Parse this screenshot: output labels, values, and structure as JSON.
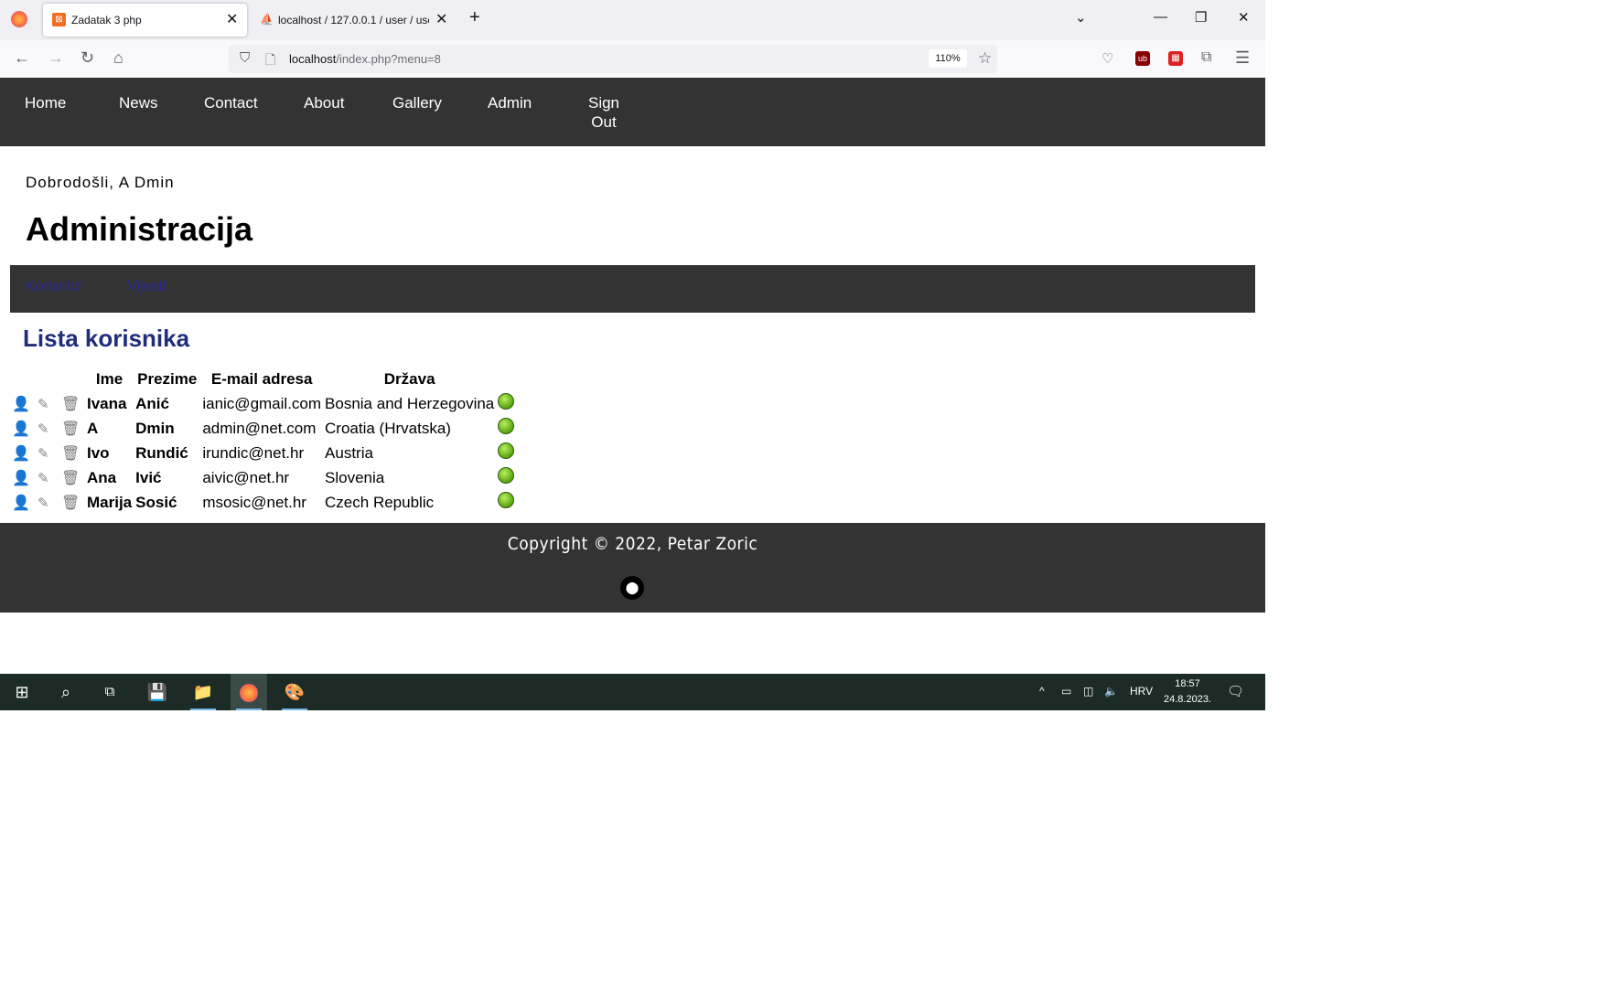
{
  "browser": {
    "tabs": [
      {
        "title": "Zadatak 3 php",
        "favicon": "xampp-icon",
        "active": true
      },
      {
        "title": "localhost / 127.0.0.1 / user / use",
        "favicon": "phpmyadmin-icon",
        "active": false
      }
    ],
    "url": {
      "host": "localhost",
      "path": "/index.php?menu=8"
    },
    "zoom": "110%"
  },
  "site": {
    "nav": [
      "Home",
      "News",
      "Contact",
      "About",
      "Gallery",
      "Admin",
      "Sign\nOut"
    ],
    "welcome": "Dobrodošli, A Dmin",
    "title": "Administracija",
    "subnav": [
      "Korisnici",
      "Vijesti"
    ],
    "list_title": "Lista korisnika",
    "table": {
      "headers": [
        "Ime",
        "Prezime",
        "E-mail adresa",
        "Država"
      ],
      "rows": [
        {
          "ime": "Ivana",
          "prezime": "Anić",
          "email": "ianic@gmail.com",
          "drzava": "Bosnia and Herzegovina"
        },
        {
          "ime": "A",
          "prezime": "Dmin",
          "email": "admin@net.com",
          "drzava": "Croatia (Hrvatska)"
        },
        {
          "ime": "Ivo",
          "prezime": "Rundić",
          "email": "irundic@net.hr",
          "drzava": "Austria"
        },
        {
          "ime": "Ana",
          "prezime": "Ivić",
          "email": "aivic@net.hr",
          "drzava": "Slovenia"
        },
        {
          "ime": "Marija",
          "prezime": "Sosić",
          "email": "msosic@net.hr",
          "drzava": "Czech Republic"
        }
      ]
    },
    "footer": {
      "copyright": "Copyright © 2022, Petar Zoric"
    }
  },
  "taskbar": {
    "language": "HRV",
    "time": "18:57",
    "date": "24.8.2023."
  },
  "colors": {
    "nav_bg": "#333333",
    "title_blue": "#1f2d7a",
    "link_dark_blue": "#2a2a9a",
    "status_green": "#5aa312"
  }
}
